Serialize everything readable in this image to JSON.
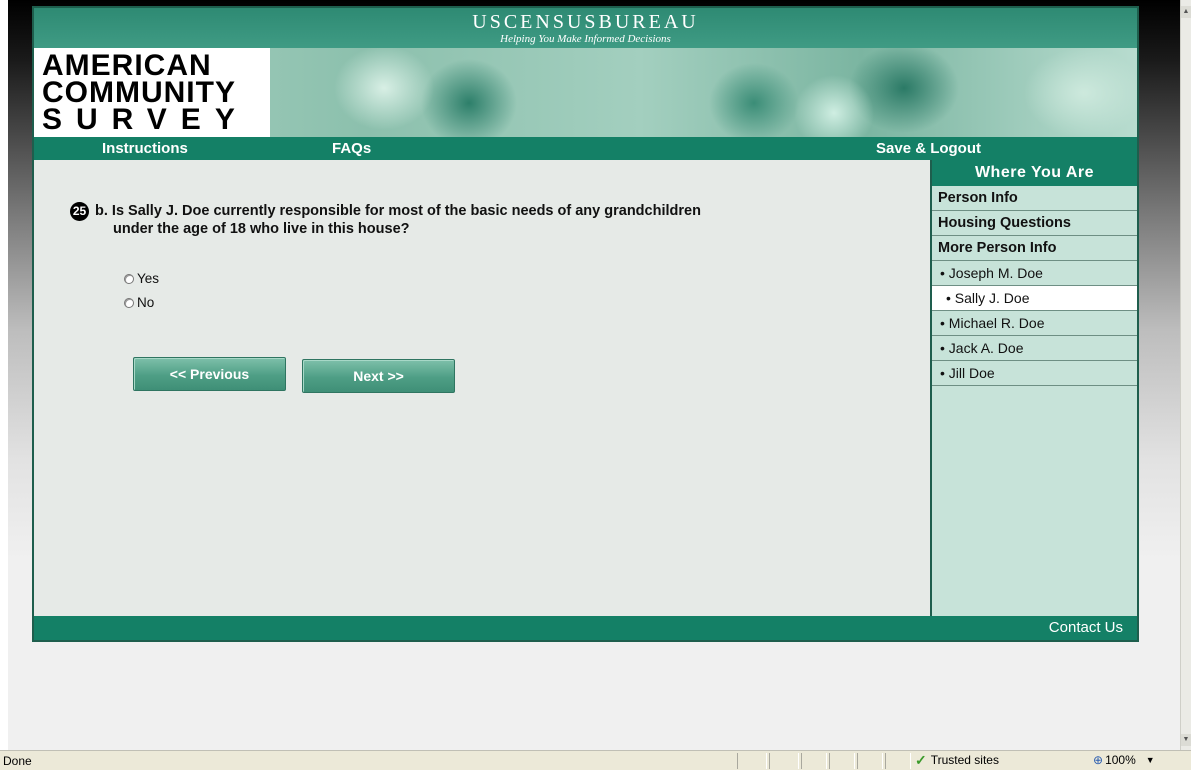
{
  "header": {
    "title": "USCENSUSBUREAU",
    "subtitle": "Helping You Make Informed Decisions"
  },
  "logo": {
    "line1": "AMERICAN",
    "line2": "COMMUNITY",
    "line3": "SURVEY"
  },
  "nav": {
    "instructions": "Instructions",
    "faqs": "FAQs",
    "save_logout": "Save & Logout"
  },
  "question": {
    "number": "25",
    "line1": "b. Is Sally J. Doe currently responsible for most of the basic needs of any grandchildren",
    "line2": "under the age of 18 who live in this house?",
    "options": [
      {
        "label": "Yes",
        "selected": false
      },
      {
        "label": "No",
        "selected": false
      }
    ]
  },
  "buttons": {
    "previous": "<<  Previous",
    "next": "Next  >>"
  },
  "sidebar": {
    "heading": "Where You Are",
    "sections": [
      "Person Info",
      "Housing Questions",
      "More Person Info"
    ],
    "persons": [
      {
        "label": "• Joseph M. Doe",
        "active": false
      },
      {
        "label": "• Sally J. Doe",
        "active": true
      },
      {
        "label": "• Michael R. Doe",
        "active": false
      },
      {
        "label": "• Jack A. Doe",
        "active": false
      },
      {
        "label": "• Jill Doe",
        "active": false
      }
    ]
  },
  "footer": {
    "contact": "Contact Us"
  },
  "statusbar": {
    "status": "Done",
    "zone": "Trusted sites",
    "zoom": "100%"
  },
  "colors": {
    "brand_green": "#148066",
    "sidebar_bg": "#c7e3d9",
    "content_bg": "#e6eae7"
  }
}
